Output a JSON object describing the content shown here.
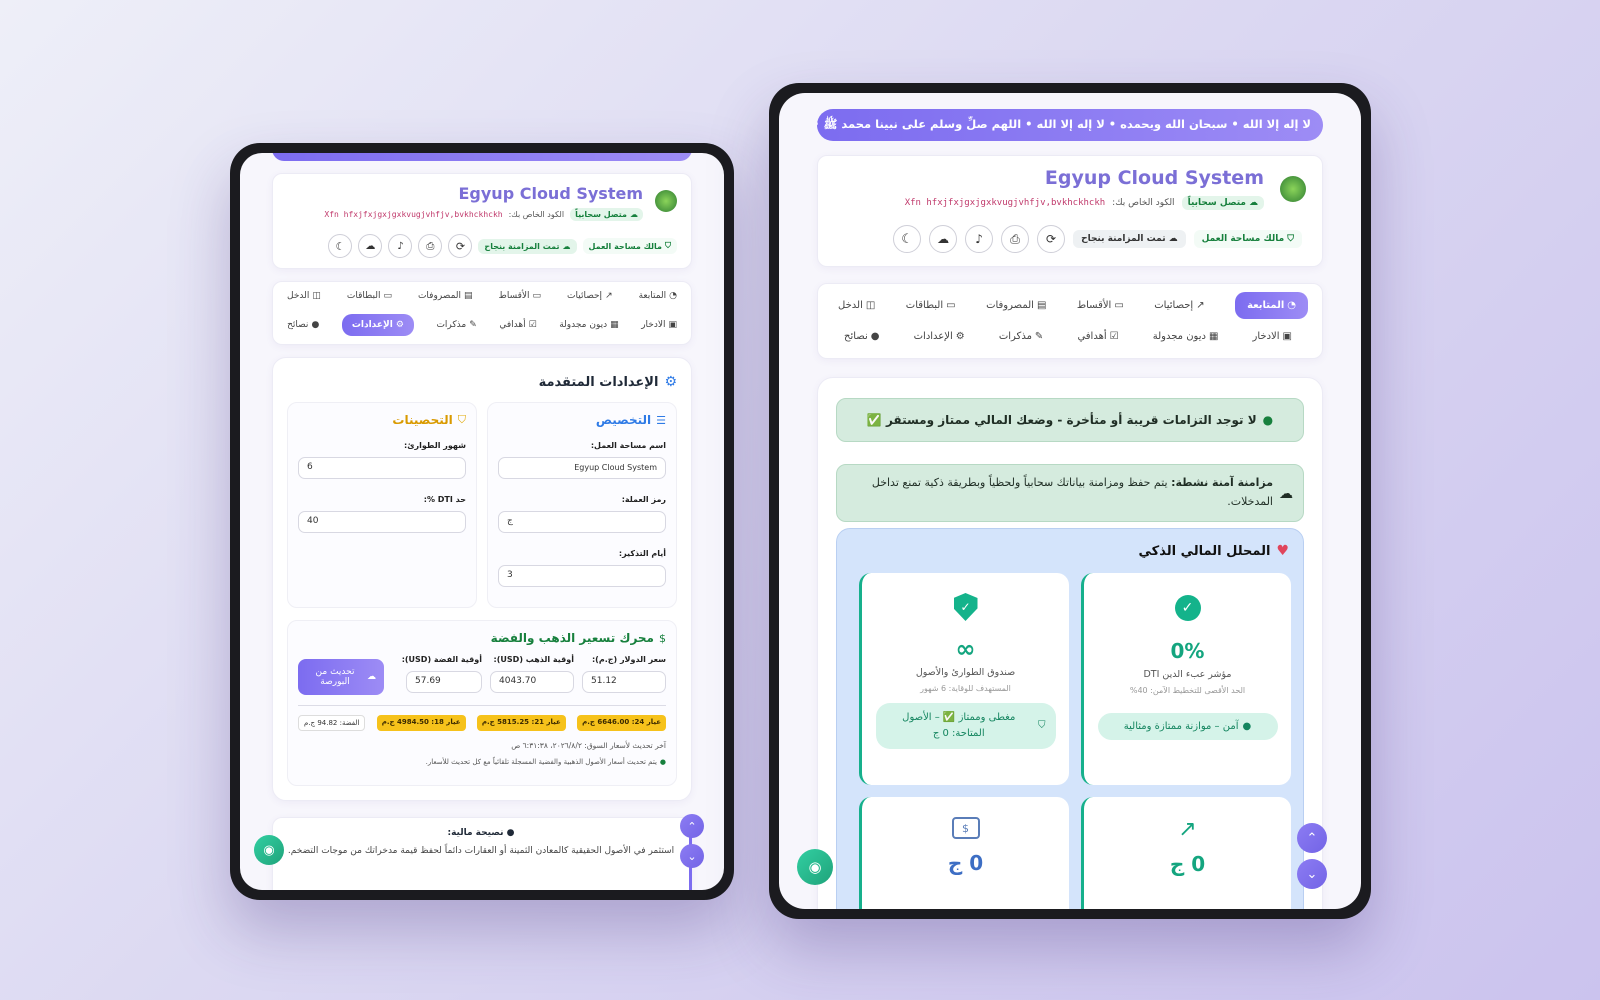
{
  "app": {
    "title": "Egyup Cloud System",
    "online_badge": "متصل سحابياً",
    "code_label": "الكود الخاص بك:",
    "code_value": "Xfn hfxjfxjgxjgxkvugjvhfjv,bvkhckhckh",
    "owner_badge": "مالك مساحة العمل",
    "sync_badge": "تمت المزامنة بنجاح",
    "logo_text": "EgyupCloud"
  },
  "ticker": "لا إله إلا الله • سبحان الله وبحمده • لا إله إلا الله • اللهم صلِّ وسلم على نبينا محمد ﷺ • لا حول ولا قوة إلا بالله",
  "tabs": [
    {
      "label": "المتابعة",
      "icon": "pie"
    },
    {
      "label": "إحصائيات",
      "icon": "chart"
    },
    {
      "label": "الأقساط",
      "icon": "card"
    },
    {
      "label": "المصروفات",
      "icon": "receipt"
    },
    {
      "label": "البطاقات",
      "icon": "card"
    },
    {
      "label": "الدخل",
      "icon": "money"
    },
    {
      "label": "الادخار",
      "icon": "save"
    },
    {
      "label": "ديون مجدولة",
      "icon": "calendar"
    },
    {
      "label": "أهدافي",
      "icon": "check"
    },
    {
      "label": "مذكرات",
      "icon": "note"
    },
    {
      "label": "الإعدادات",
      "icon": "gear"
    },
    {
      "label": "نصائح",
      "icon": "bulb"
    }
  ],
  "settings": {
    "title": "الإعدادات المتقدمة",
    "custom": {
      "title": "التخصيص",
      "workspace_label": "اسم مساحة العمل:",
      "workspace_value": "Egyup Cloud System",
      "currency_label": "رمز العملة:",
      "currency_value": "ج",
      "reminder_label": "أيام التذكير:",
      "reminder_value": "3"
    },
    "fortify": {
      "title": "التحصينات",
      "emergency_label": "شهور الطوارئ:",
      "emergency_value": "6",
      "dti_label": "حد DTI %:",
      "dti_value": "40"
    }
  },
  "gold": {
    "title": "محرك تسعير الذهب والفضة",
    "usd_label": "سعر الدولار (ج.م):",
    "usd_value": "51.12",
    "gold_label": "أوقية الذهب (USD):",
    "gold_value": "4043.70",
    "silver_label": "أوقية الفضة (USD):",
    "silver_value": "57.69",
    "update_btn": "تحديث من البورصة",
    "badges": [
      "عيار 24: 6646.00 ج.م",
      "عيار 21: 5815.25 ج.م",
      "عيار 18: 4984.50 ج.م",
      "الفضة: 94.82 ج.م"
    ],
    "last_update": "آخر تحديث لأسعار السوق: ٢٠٢٦/٨/٢، ٦:٣١:٣٨ ص",
    "auto_note": "يتم تحديث أسعار الأصول الذهبية والفضية المسجلة تلقائياً مع كل تحديث للأسعار."
  },
  "tip": {
    "title": "نصيحة مالية:",
    "text": "استثمر في الأصول الحقيقية كالمعادن الثمينة أو العقارات دائماً لحفظ قيمة مدخراتك من موجات التضخم."
  },
  "alerts": {
    "no_debts": "لا توجد التزامات قريبة أو متأخرة - وضعك المالي ممتاز ومستقر ✅",
    "sync_title": "مزامنة آمنة نشطة:",
    "sync_text": "يتم حفظ ومزامنة بياناتك سحابياً ولحظياً وبطريقة ذكية تمنع تداخل المدخلات."
  },
  "analyzer": {
    "title": "المحلل المالي الذكي",
    "dti": {
      "value": "0%",
      "label": "مؤشر عبء الدين DTI",
      "sub": "الحد الأقصى للتخطيط الآمن: 40%",
      "status": "آمن – موازنة ممتازة ومثالية"
    },
    "emergency": {
      "value": "∞",
      "label": "صندوق الطوارئ والأصول",
      "sub": "المستهدف للوقاية: 6 شهور",
      "status": "مغطى وممتاز ✅ – الأصول المتاحة: 0 ج"
    },
    "card3_value": "0 ج",
    "card4_value": "0 ج"
  },
  "colors": {
    "accent": "#7c6cf0",
    "green": "#16b08c",
    "gold": "#f6c21b"
  }
}
